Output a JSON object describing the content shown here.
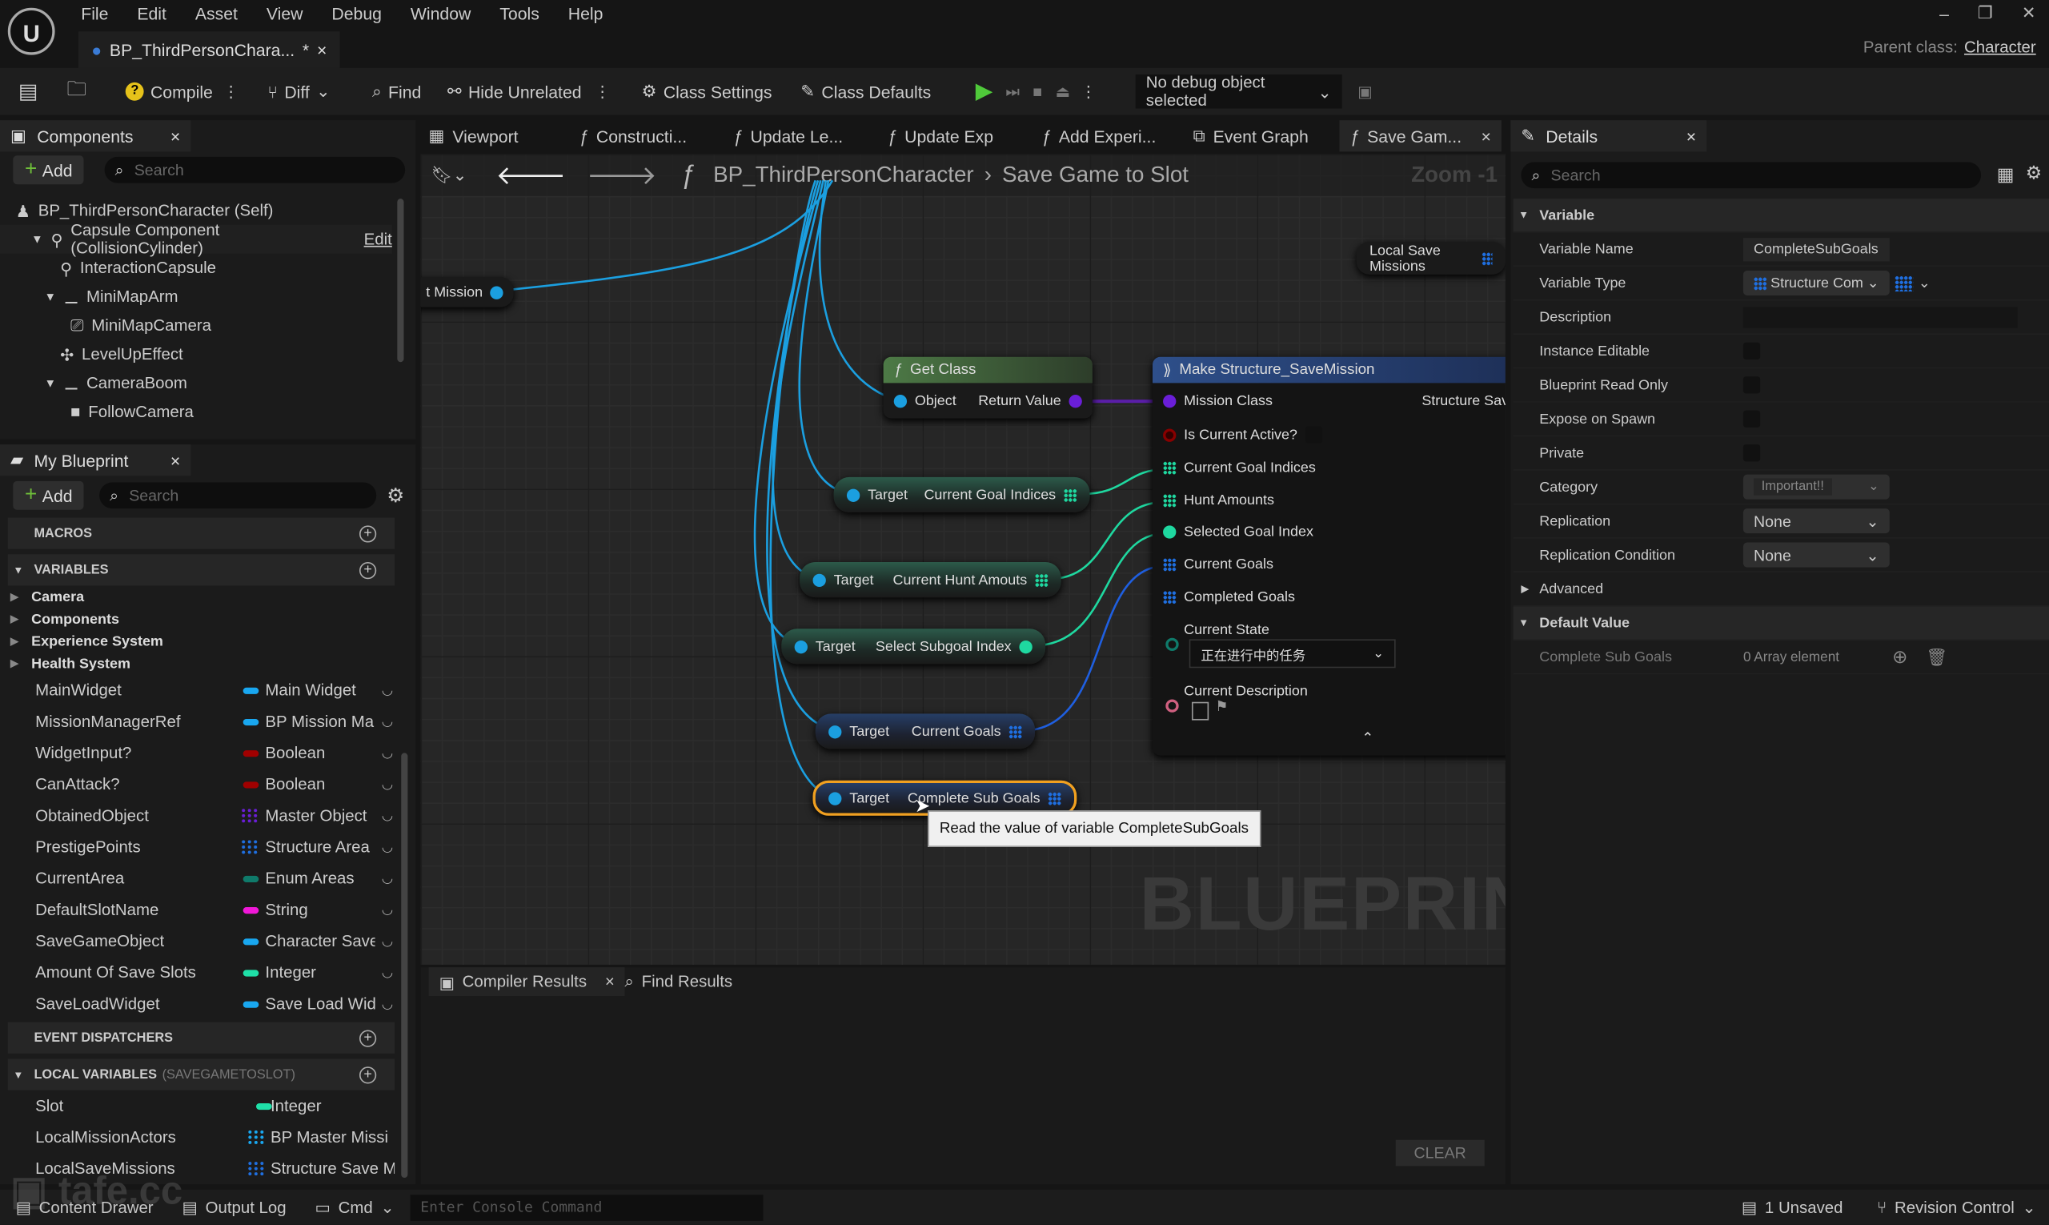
{
  "menu": [
    "File",
    "Edit",
    "Asset",
    "View",
    "Debug",
    "Window",
    "Tools",
    "Help"
  ],
  "document_tab": {
    "title": "BP_ThirdPersonChara...",
    "modified": "*"
  },
  "parent_class": {
    "label": "Parent class:",
    "value": "Character"
  },
  "toolbar": {
    "compile": "Compile",
    "diff": "Diff",
    "find": "Find",
    "hide_unrelated": "Hide Unrelated",
    "class_settings": "Class Settings",
    "class_defaults": "Class Defaults",
    "debug_object": "No debug object selected"
  },
  "components": {
    "title": "Components",
    "add": "Add",
    "search_placeholder": "Search",
    "tree": [
      {
        "label": "BP_ThirdPersonCharacter (Self)",
        "depth": 0
      },
      {
        "label": "Capsule Component (CollisionCylinder)",
        "depth": 1,
        "extra": "Edit"
      },
      {
        "label": "InteractionCapsule",
        "depth": 2
      },
      {
        "label": "MiniMapArm",
        "depth": 2
      },
      {
        "label": "MiniMapCamera",
        "depth": 3
      },
      {
        "label": "LevelUpEffect",
        "depth": 2
      },
      {
        "label": "CameraBoom",
        "depth": 2
      },
      {
        "label": "FollowCamera",
        "depth": 3
      }
    ]
  },
  "my_blueprint": {
    "title": "My Blueprint",
    "add": "Add",
    "search_placeholder": "Search",
    "macros": "MACROS",
    "variables": "VARIABLES",
    "categories": [
      "Camera",
      "Components",
      "Experience System",
      "Health System"
    ],
    "vars": [
      {
        "name": "MainWidget",
        "type": "Main Widget",
        "color": "#19a7f0",
        "kind": "pill"
      },
      {
        "name": "MissionManagerRef",
        "type": "BP Mission Ma",
        "color": "#19a7f0",
        "kind": "pill"
      },
      {
        "name": "WidgetInput?",
        "type": "Boolean",
        "color": "#a00000",
        "kind": "pill"
      },
      {
        "name": "CanAttack?",
        "type": "Boolean",
        "color": "#a00000",
        "kind": "pill"
      },
      {
        "name": "ObtainedObject",
        "type": "Master Object",
        "color": "#6a1ed8",
        "kind": "grid"
      },
      {
        "name": "PrestigePoints",
        "type": "Structure Area",
        "color": "#1f6fe0",
        "kind": "grid"
      },
      {
        "name": "CurrentArea",
        "type": "Enum Areas",
        "color": "#0f7a6a",
        "kind": "pill"
      },
      {
        "name": "DefaultSlotName",
        "type": "String",
        "color": "#f018d8",
        "kind": "pill"
      },
      {
        "name": "SaveGameObject",
        "type": "Character Save",
        "color": "#19a7f0",
        "kind": "pill"
      },
      {
        "name": "Amount Of Save Slots",
        "type": "Integer",
        "color": "#1fe0a8",
        "kind": "pill"
      },
      {
        "name": "SaveLoadWidget",
        "type": "Save Load Wid",
        "color": "#19a7f0",
        "kind": "pill"
      }
    ],
    "event_dispatchers": "EVENT DISPATCHERS",
    "local_variables": "LOCAL VARIABLES",
    "local_scope": "(SAVEGAMETOSLOT)",
    "locals": [
      {
        "name": "Slot",
        "type": "Integer",
        "color": "#1fe0a8",
        "kind": "pill"
      },
      {
        "name": "LocalMissionActors",
        "type": "BP Master Missi",
        "color": "#19a7f0",
        "kind": "grid"
      },
      {
        "name": "LocalSaveMissions",
        "type": "Structure Save M",
        "color": "#1f6fe0",
        "kind": "grid"
      }
    ]
  },
  "graph_tabs": [
    "Viewport",
    "Constructi...",
    "Update Le...",
    "Update Exp",
    "Add Experi...",
    "Event Graph",
    "Save Gam..."
  ],
  "breadcrumb": {
    "root": "BP_ThirdPersonCharacter",
    "current": "Save Game to Slot",
    "zoom": "Zoom -1"
  },
  "nodes": {
    "local_save_missions": "Local Save Missions",
    "mission_partial": "t Mission",
    "get_class": {
      "title": "Get Class",
      "in": "Object",
      "out": "Return Value"
    },
    "make_struct": {
      "title": "Make Structure_SaveMission",
      "out": "Structure Save",
      "pins": [
        "Mission Class",
        "Is Current Active?",
        "Current Goal Indices",
        "Hunt Amounts",
        "Selected Goal Index",
        "Current Goals",
        "Completed Goals"
      ],
      "state_label": "Current State",
      "state_value": "正在进行中的任务",
      "desc_label": "Current Description"
    },
    "getters": [
      {
        "in": "Target",
        "out": "Current Goal Indices"
      },
      {
        "in": "Target",
        "out": "Current Hunt Amouts"
      },
      {
        "in": "Target",
        "out": "Select Subgoal Index"
      },
      {
        "in": "Target",
        "out": "Current Goals"
      },
      {
        "in": "Target",
        "out": "Complete Sub Goals"
      }
    ]
  },
  "tooltip": "Read the value of variable CompleteSubGoals",
  "watermark": "BLUEPRINT",
  "bottom": {
    "tabs": [
      "Compiler Results",
      "Find Results"
    ],
    "clear": "CLEAR"
  },
  "details": {
    "title": "Details",
    "search_placeholder": "Search",
    "variable_section": "Variable",
    "rows": {
      "variable_name": {
        "label": "Variable Name",
        "value": "CompleteSubGoals"
      },
      "variable_type": {
        "label": "Variable Type",
        "value": "Structure Com"
      },
      "description": {
        "label": "Description",
        "value": ""
      },
      "instance_editable": {
        "label": "Instance Editable",
        "checked": false
      },
      "blueprint_read_only": {
        "label": "Blueprint Read Only",
        "checked": false
      },
      "expose_on_spawn": {
        "label": "Expose on Spawn",
        "checked": false
      },
      "private": {
        "label": "Private",
        "checked": false
      },
      "category": {
        "label": "Category",
        "value": "Important!!"
      },
      "replication": {
        "label": "Replication",
        "value": "None"
      },
      "replication_condition": {
        "label": "Replication Condition",
        "value": "None"
      }
    },
    "advanced": "Advanced",
    "default_section": "Default Value",
    "default_row": {
      "label": "Complete Sub Goals",
      "value": "0 Array element"
    }
  },
  "status": {
    "content_drawer": "Content Drawer",
    "output_log": "Output Log",
    "cmd": "Cmd",
    "console_placeholder": "Enter Console Command",
    "unsaved": "1 Unsaved",
    "revision": "Revision Control"
  },
  "logo_watermark": "tafe.cc"
}
